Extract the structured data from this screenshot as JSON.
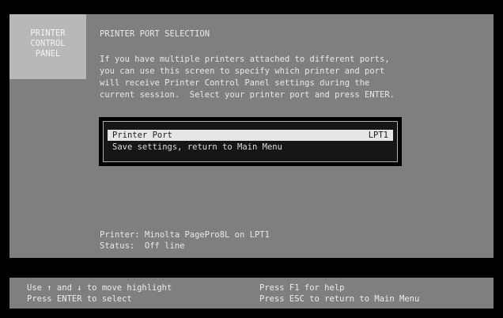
{
  "panel": {
    "side_lines": [
      "PRINTER",
      "CONTROL",
      "PANEL"
    ],
    "title": "PRINTER PORT SELECTION",
    "description_lines": [
      "If you have multiple printers attached to different ports,",
      "you can use this screen to specify which printer and port",
      "will receive Printer Control Panel settings during the",
      "current session.  Select your printer port and press ENTER."
    ]
  },
  "menu": {
    "items": [
      {
        "label": "Printer Port",
        "value": "LPT1"
      },
      {
        "label": "Save settings, return to Main Menu",
        "value": ""
      }
    ]
  },
  "printer_info": {
    "printer_line": "Printer: Minolta PagePro8L on LPT1",
    "status_line": "Status:  Off line"
  },
  "help_bar": {
    "line1_left": "Use ↑ and ↓ to move highlight",
    "line2_left": "Press ENTER to select",
    "line1_right": "Press F1 for help",
    "line2_right": "Press ESC to return to Main Menu"
  },
  "colors": {
    "background": "#000000",
    "panel": "#7f7f7f",
    "side_panel": "#b8b8b8",
    "highlight": "#e6e6e6"
  }
}
